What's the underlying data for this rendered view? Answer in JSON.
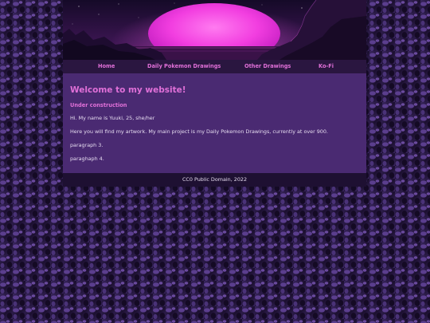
{
  "nav": {
    "items": [
      {
        "label": "Home"
      },
      {
        "label": "Daily Pokemon Drawings"
      },
      {
        "label": "Other Drawings"
      },
      {
        "label": "Ko-Fi"
      }
    ]
  },
  "main": {
    "title": "Welcome to my website!",
    "subtitle": "Under construction",
    "paragraphs": [
      "Hi. My name is Yuuki, 25, she/her",
      "Here you will find my artwork. My main project is my Daily Pokemon Drawings, currently at over 900.",
      "paragraph 3.",
      "paraghaph 4."
    ]
  },
  "footer": {
    "text": "CC0 Public Domain, 2022"
  },
  "colors": {
    "accent": "#e070d8",
    "content_bg": "#4a2a72",
    "nav_bg": "#2a1640",
    "footer_bg": "#1e1032"
  }
}
